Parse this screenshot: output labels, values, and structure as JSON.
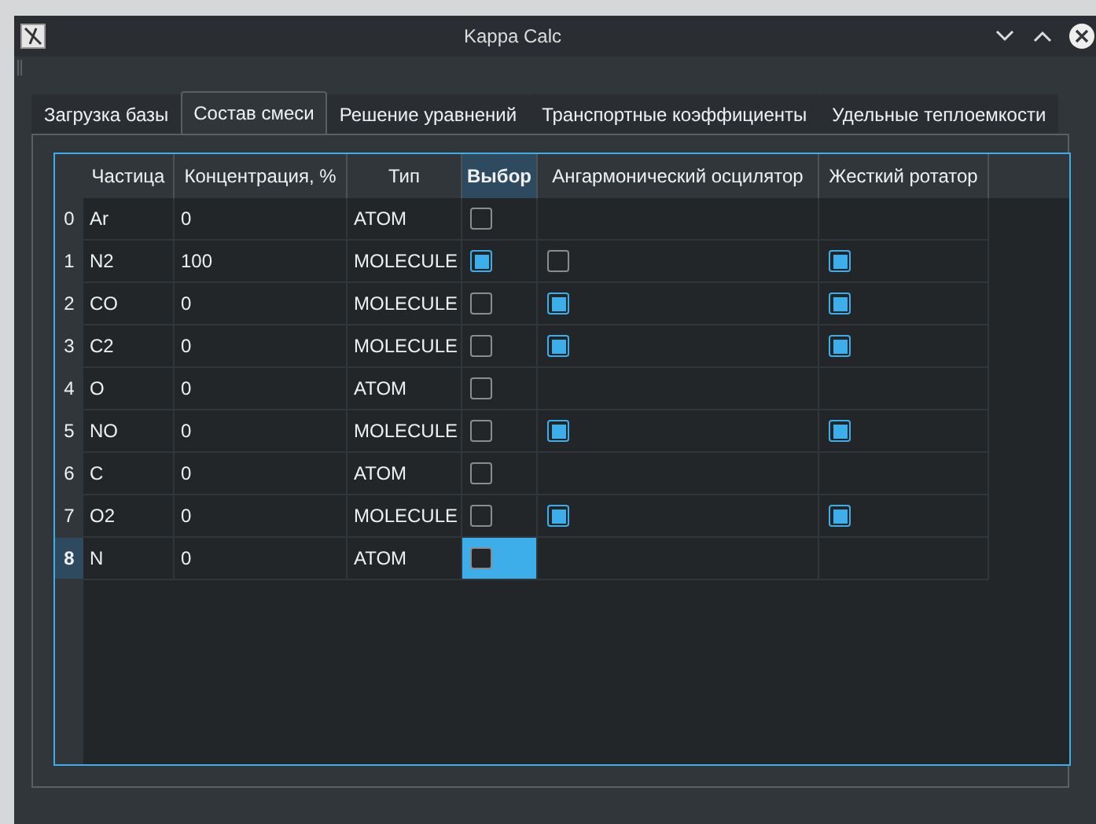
{
  "window": {
    "title": "Kappa Calc"
  },
  "tabs": [
    {
      "label": "Загрузка базы",
      "selected": false
    },
    {
      "label": "Состав смеси",
      "selected": true
    },
    {
      "label": "Решение уравнений",
      "selected": false
    },
    {
      "label": "Транспортные коэффициенты",
      "selected": false
    },
    {
      "label": "Удельные теплоемкости",
      "selected": false
    }
  ],
  "table": {
    "columns": [
      {
        "label": "Частица",
        "current": false
      },
      {
        "label": "Концентрация, %",
        "current": false
      },
      {
        "label": "Тип",
        "current": false
      },
      {
        "label": "Выбор",
        "current": true
      },
      {
        "label": "Ангармонический осцилятор",
        "current": false
      },
      {
        "label": "Жесткий ротатор",
        "current": false
      }
    ],
    "rows": [
      {
        "index": "0",
        "particle": "Ar",
        "concentration": "0",
        "type": "ATOM",
        "checked": false,
        "current": false
      },
      {
        "index": "1",
        "particle": "N2",
        "concentration": "100",
        "type": "MOLECULE",
        "checked": true,
        "anharmonic": false,
        "rigid_rotator": true,
        "current": false
      },
      {
        "index": "2",
        "particle": "CO",
        "concentration": "0",
        "type": "MOLECULE",
        "checked": false,
        "anharmonic": true,
        "rigid_rotator": true,
        "current": false
      },
      {
        "index": "3",
        "particle": "C2",
        "concentration": "0",
        "type": "MOLECULE",
        "checked": false,
        "anharmonic": true,
        "rigid_rotator": true,
        "current": false
      },
      {
        "index": "4",
        "particle": "O",
        "concentration": "0",
        "type": "ATOM",
        "checked": false,
        "current": false
      },
      {
        "index": "5",
        "particle": "NO",
        "concentration": "0",
        "type": "MOLECULE",
        "checked": false,
        "anharmonic": true,
        "rigid_rotator": true,
        "current": false
      },
      {
        "index": "6",
        "particle": "C",
        "concentration": "0",
        "type": "ATOM",
        "checked": false,
        "current": false
      },
      {
        "index": "7",
        "particle": "O2",
        "concentration": "0",
        "type": "MOLECULE",
        "checked": false,
        "anharmonic": true,
        "rigid_rotator": true,
        "current": false
      },
      {
        "index": "8",
        "particle": "N",
        "concentration": "0",
        "type": "ATOM",
        "checked": false,
        "current": true
      }
    ]
  }
}
